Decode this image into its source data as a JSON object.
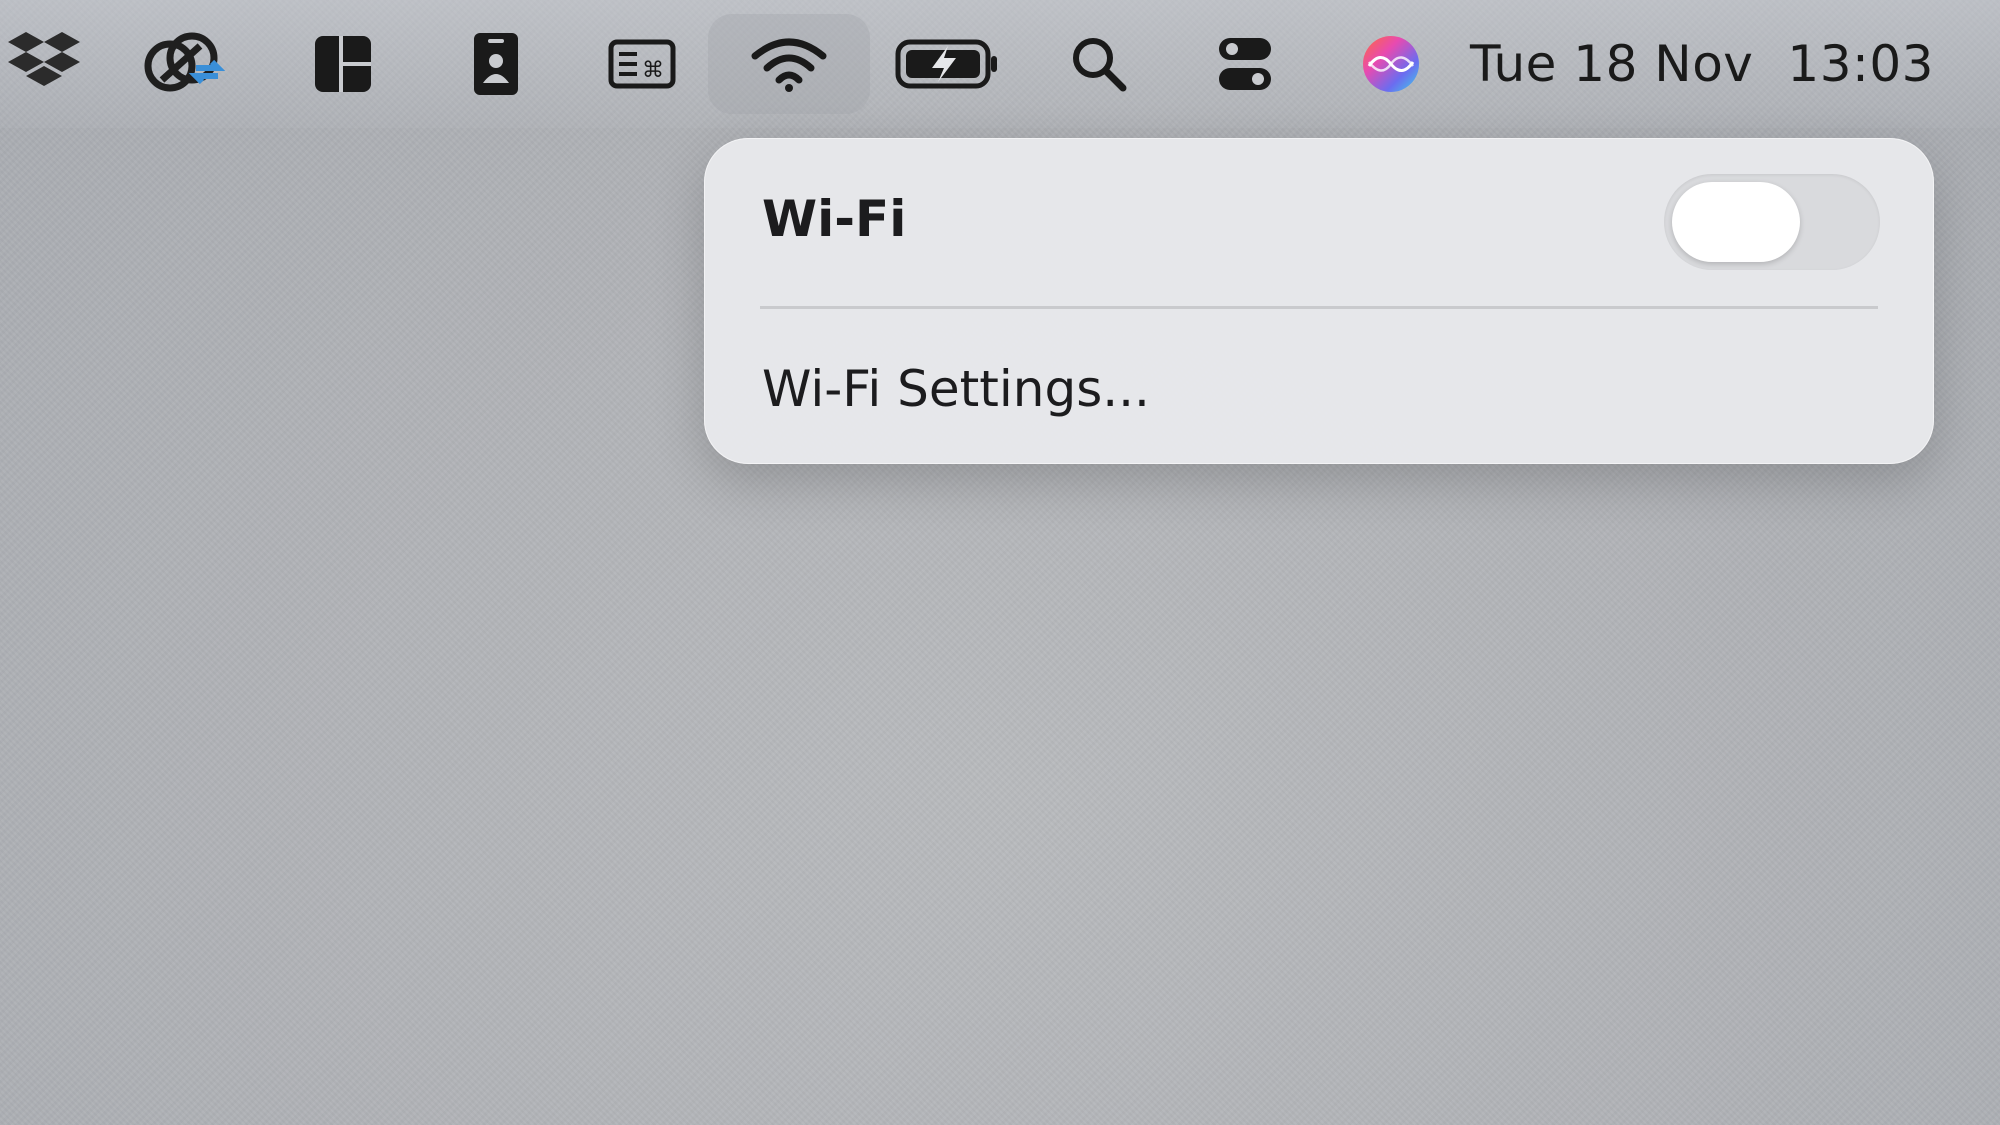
{
  "menubar": {
    "icons": [
      {
        "name": "dropbox-icon"
      },
      {
        "name": "cloud-sync-icon"
      },
      {
        "name": "window-layout-icon"
      },
      {
        "name": "id-badge-icon"
      },
      {
        "name": "keyboard-shortcuts-icon"
      },
      {
        "name": "wifi-icon"
      },
      {
        "name": "battery-charging-icon"
      },
      {
        "name": "spotlight-search-icon"
      },
      {
        "name": "control-center-icon"
      },
      {
        "name": "siri-icon"
      }
    ],
    "date": "Tue 18 Nov",
    "time": "13:03"
  },
  "wifi_menu": {
    "title": "Wi-Fi",
    "toggle_on": false,
    "settings_label": "Wi-Fi Settings..."
  },
  "colors": {
    "icon": "#1a1a1a",
    "accent_blue": "#3a8fd8",
    "panel_bg": "#e8e9ec",
    "toggle_off": "#d9dadd"
  }
}
